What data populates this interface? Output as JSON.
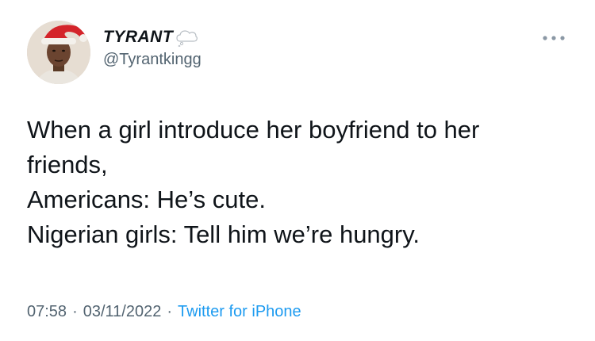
{
  "tweet": {
    "author": {
      "display_name": "TYRANT",
      "badge_icon": "cloud-icon",
      "handle": "@Tyrantkingg",
      "avatar_icon": "avatar-santa-hat"
    },
    "more_icon": "more-horizontal-icon",
    "text_lines": [
      "When a girl introduce her boyfriend to her",
      "friends,",
      "Americans: He’s cute.",
      "Nigerian girls: Tell him we’re hungry."
    ],
    "meta": {
      "time": "07:58",
      "separator": "·",
      "date": "03/11/2022",
      "source": "Twitter for iPhone"
    }
  },
  "colors": {
    "text": "#0f1419",
    "secondary": "#536471",
    "link": "#1d9bf0",
    "background": "#ffffff"
  }
}
